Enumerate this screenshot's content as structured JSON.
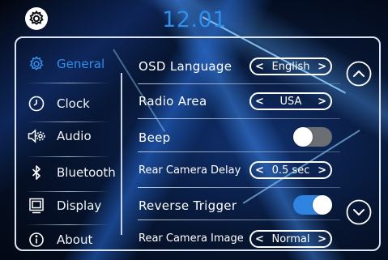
{
  "header": {
    "time": "12.01",
    "settings_icon": "gear-icon"
  },
  "nav": {
    "items": [
      {
        "label": "General",
        "icon": "gear-icon",
        "active": true
      },
      {
        "label": "Clock",
        "icon": "clock-icon",
        "active": false
      },
      {
        "label": "Audio",
        "icon": "speaker-icon",
        "active": false
      },
      {
        "label": "Bluetooth",
        "icon": "bluetooth-icon",
        "active": false
      },
      {
        "label": "Display",
        "icon": "display-icon",
        "active": false
      },
      {
        "label": "About",
        "icon": "info-icon",
        "active": false
      }
    ]
  },
  "settings": {
    "osd_language": {
      "label": "OSD Language",
      "value": "English"
    },
    "radio_area": {
      "label": "Radio Area",
      "value": "USA"
    },
    "beep": {
      "label": "Beep",
      "enabled": false
    },
    "rear_camera_delay": {
      "label": "Rear Camera Delay",
      "value": "0.5 sec"
    },
    "reverse_trigger": {
      "label": "Reverse Trigger",
      "enabled": true
    },
    "rear_camera_image": {
      "label": "Rear Camera Image",
      "value": "Normal"
    }
  },
  "scroll": {
    "up_icon": "chevron-up-icon",
    "down_icon": "chevron-down-icon"
  },
  "colors": {
    "accent": "#2f8fea",
    "toggle_on": "#2f84e0",
    "toggle_off": "#6b6e73",
    "frame": "#d9e3f2"
  }
}
